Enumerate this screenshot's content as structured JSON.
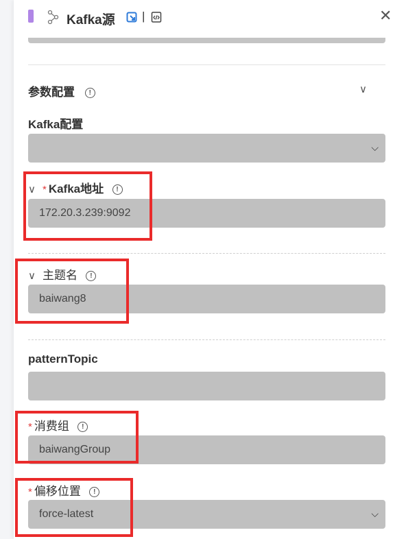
{
  "header": {
    "title": "Kafka源",
    "separator": "|",
    "close": "✕"
  },
  "section": {
    "title": "参数配置"
  },
  "fields": {
    "kafka_config": {
      "label": "Kafka配置",
      "value": ""
    },
    "kafka_address": {
      "label": "Kafka地址",
      "value": "172.20.3.239:9092",
      "required": "*"
    },
    "topic_name": {
      "label": "主题名",
      "value": "baiwang8"
    },
    "pattern_topic": {
      "label": "patternTopic",
      "value": ""
    },
    "consumer_group": {
      "label": "消费组",
      "value": "baiwangGroup",
      "required": "*"
    },
    "offset_position": {
      "label": "偏移位置",
      "value": "force-latest",
      "required": "*"
    }
  }
}
